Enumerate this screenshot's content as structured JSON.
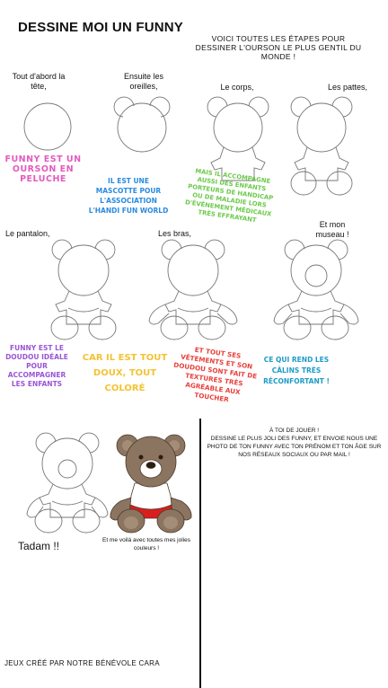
{
  "title": "DESSINE MOI UN FUNNY",
  "intro": "VOICI TOUTES LES ÉTAPES POUR DESSINER L'OURSON LE PLUS GENTIL DU MONDE !",
  "steps": {
    "head": "Tout d'abord la tête,",
    "ears": "Ensuite les oreilles,",
    "body": "Le corps,",
    "paws": "Les pattes,",
    "pants": "Le pantalon,",
    "arms": "Les bras,",
    "snout": "Et mon museau !"
  },
  "notes": {
    "plush": "FUNNY EST UN OURSON EN PELUCHE",
    "mascot": "IL EST UNE MASCOTTE POUR L'ASSOCIATION L'HANDI FUN WORLD",
    "accompany": "MAIS IL ACCOMPAGNE AUSSI DES ENFANTS PORTEURS DE HANDICAP OU DE MALADIE LORS D'ÉVÉNEMENT MÉDICAUX TRÈS EFFRAYANT",
    "ideal": "FUNNY EST LE DOUDOU IDÉALE POUR ACCOMPAGNER LES ENFANTS",
    "soft": "CAR IL EST TOUT DOUX, TOUT COLORÉ",
    "textures": "ET TOUT SES VÊTEMENTS ET SON DOUDOU SONT FAIT DE TEXTURES TRÈS AGRÉABLE AUX TOUCHER",
    "comfort": "CE QUI REND LES CÂLINS TRÈS RÉCONFORTANT !"
  },
  "rules": {
    "line1": "À TOI DE JOUER !",
    "line2": "DESSINE LE PLUS JOLI DES FUNNY, ET ENVOIE NOUS UNE PHOTO DE TON FUNNY AVEC TON PRÉNOM ET TON ÂGE SUR NOS RÉSEAUX SOCIAUX OU PAR MAIL !"
  },
  "tadam": "Tadam !!",
  "colors_caption": "Et me voilà avec toutes mes jolies couleurs !",
  "footer": "JEUX CRÉÉ PAR NOTRE BÉNÉVOLE CARA",
  "colors": {
    "pink": "#e45ac0",
    "blue": "#2a8be0",
    "green": "#6bc94b",
    "purple": "#9a55d6",
    "yellow": "#f4c233",
    "red": "#e8403c",
    "teal": "#1f9bc6",
    "bear_brown": "#8c7560",
    "pants_red": "#d91e1e"
  }
}
